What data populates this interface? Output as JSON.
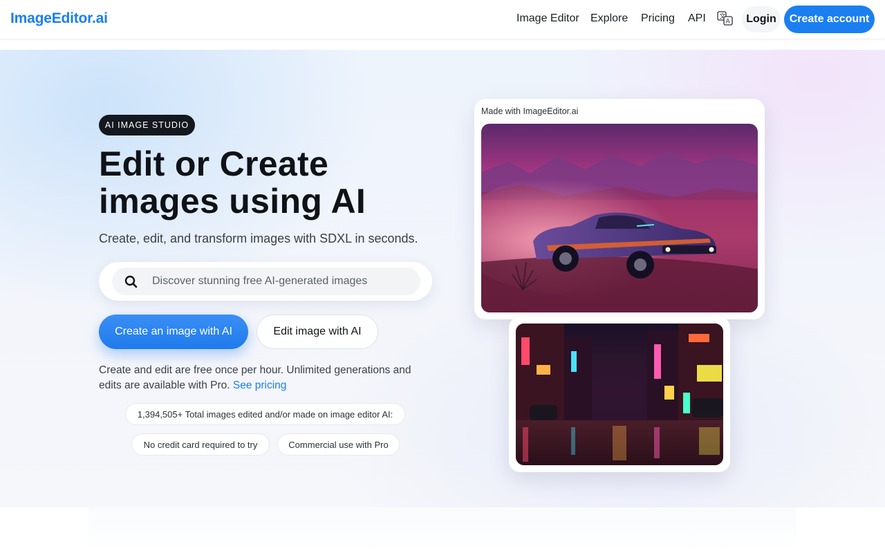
{
  "header": {
    "brand": "ImageEditor.ai",
    "nav": [
      {
        "label": "Image Editor"
      },
      {
        "label": "Explore"
      },
      {
        "label": "Pricing"
      },
      {
        "label": "API"
      }
    ],
    "translate_icon": "translate-icon",
    "login_label": "Login",
    "create_account_label": "Create account",
    "accent_color": "#1a7ff0"
  },
  "hero": {
    "badge": "AI IMAGE STUDIO",
    "headline_line1": "Edit or Create",
    "headline_line2": "images using AI",
    "subhead": "Create, edit, and transform images with SDXL in seconds.",
    "search": {
      "icon": "search-icon",
      "placeholder": "Discover stunning free AI-generated images"
    },
    "primary_cta": "Create an image with AI",
    "secondary_cta": "Edit image with AI",
    "note_text": "Create and edit are free once per hour. Unlimited generations and edits are available with Pro.",
    "note_link": "See pricing",
    "chips": {
      "total": "1,394,505+ Total images edited and/or made on image editor AI:",
      "no_credit_card": "No credit card required to try",
      "commercial": "Commercial use with Pro"
    }
  },
  "showcase": {
    "main_caption": "Made with ImageEditor.ai",
    "main_image": "retro muscle car in pink desert sunset",
    "secondary_image": "neon city street at night"
  }
}
